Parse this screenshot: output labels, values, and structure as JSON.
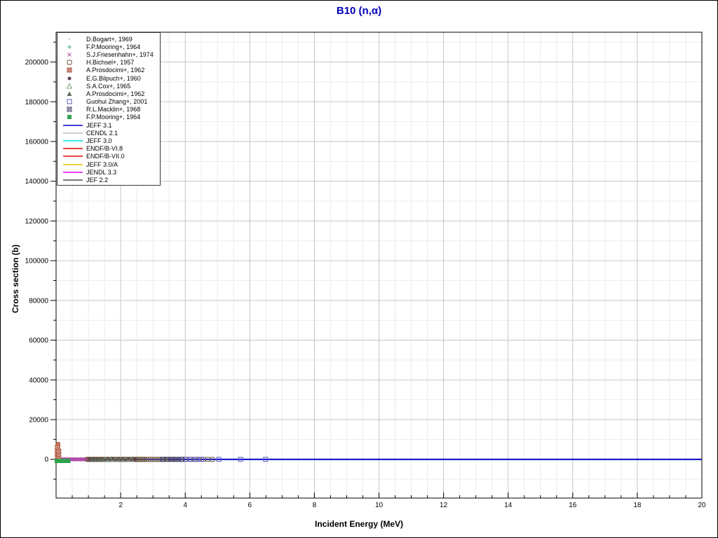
{
  "page": {
    "background": "#ffffff",
    "border_color": "#000000"
  },
  "chart_data": {
    "type": "scatter",
    "title": "B10 (n,α)",
    "title_color": "#0000bb",
    "xlabel": "Incident Energy (MeV)",
    "ylabel": "Cross section (b)",
    "xlim": [
      0,
      20
    ],
    "ylim": [
      -19500,
      215000
    ],
    "x_major_ticks": [
      2,
      4,
      6,
      8,
      10,
      12,
      14,
      16,
      18,
      20
    ],
    "x_minor_step": 0.5,
    "y_major_ticks": [
      0,
      20000,
      40000,
      60000,
      80000,
      100000,
      120000,
      140000,
      160000,
      180000,
      200000
    ],
    "y_minor_step": 10000,
    "grid": {
      "major_color": "#c6c6c6",
      "minor_color": "#ebebeb"
    },
    "zero_line_color": "#000000",
    "legend_position": "top-left",
    "evaluations": [
      {
        "name": "JEFF 3.1",
        "color": "#0000cc",
        "value": 0
      },
      {
        "name": "CENDL 2.1",
        "color": "#c0c0c0",
        "value": 0
      },
      {
        "name": "JEFF 3.0",
        "color": "#00e5e5",
        "value": 0
      },
      {
        "name": "ENDF/B-VI.8",
        "color": "#e60000",
        "value": 0
      },
      {
        "name": "ENDF/B-VII.0",
        "color": "#e60000",
        "value": 0
      },
      {
        "name": "JEFF 3.0/A",
        "color": "#e6c300",
        "value": 0
      },
      {
        "name": "JENDL 3.3",
        "color": "#e600e6",
        "value": 0
      },
      {
        "name": "JEF 2.2",
        "color": "#4d4d4d",
        "value": 0
      }
    ],
    "spike": {
      "x0": 0.005,
      "x1": 0.115,
      "y0": 0,
      "y1": 8500,
      "fill": "#c9785e",
      "stroke": "#9e4f3a"
    },
    "series": [
      {
        "id": "bogart",
        "label": "D.Bogart+, 1969",
        "marker": "dot",
        "color": "#b0b0b0",
        "x": [
          0.2,
          0.3,
          0.4,
          0.55,
          0.7,
          0.85
        ],
        "y": 0
      },
      {
        "id": "mooring-plus",
        "label": "F.P.Mooring+, 1964",
        "marker": "plus",
        "color": "#4aa87e",
        "x": [
          0.45,
          0.6,
          0.75,
          0.9
        ],
        "y": 0
      },
      {
        "id": "friesenhahn",
        "label": "S.J.Friesenhahn+, 1974",
        "marker": "x",
        "color": "#b44fae",
        "x": [
          0.13,
          0.15,
          0.17,
          0.19,
          0.21,
          0.24,
          0.26,
          0.28,
          0.3,
          0.32,
          0.35,
          0.37,
          0.39,
          0.41,
          0.43,
          0.46,
          0.48,
          0.5,
          0.52,
          0.54,
          0.57,
          0.59,
          0.61,
          0.63,
          0.65,
          0.68,
          0.7,
          0.72,
          0.74,
          0.76,
          0.79,
          0.81,
          0.83,
          0.85,
          0.87,
          0.9,
          0.92,
          0.94,
          0.96,
          0.99,
          1.01
        ],
        "y": 0
      },
      {
        "id": "bichsel",
        "label": "H.Bichsel+, 1957",
        "marker": "open-square-notch",
        "color": "#6e583c",
        "x": [
          0.98,
          1.02,
          1.06,
          1.1,
          1.14,
          1.18,
          1.22,
          1.26,
          1.3,
          1.34,
          1.38,
          1.42,
          1.46,
          1.5,
          1.54,
          1.58,
          1.62,
          1.66,
          1.7,
          1.74,
          1.78,
          1.82,
          1.86,
          1.9,
          1.94,
          1.98,
          2.02,
          2.06,
          2.1,
          2.14,
          2.18,
          2.22,
          2.26,
          2.3,
          2.34,
          2.38,
          2.42,
          2.46,
          2.5,
          2.54,
          2.58,
          2.62,
          2.66,
          2.7,
          2.74,
          2.8,
          2.86,
          2.92,
          2.98,
          3.04,
          3.1,
          3.16,
          3.22,
          3.28,
          3.34,
          3.4,
          3.46,
          3.52,
          3.58,
          3.66,
          3.76,
          3.88,
          4.0,
          4.14,
          4.28,
          4.42,
          4.56,
          4.7,
          4.84
        ],
        "y": 0
      },
      {
        "id": "prosdocimi-hatched",
        "label": "A.Prosdocimi+, 1962",
        "marker": "hatched-square",
        "color": "#aa5544",
        "fill": "#eec9a8",
        "x": [
          0.04,
          0.04,
          0.04,
          0.04,
          0.08,
          0.08,
          0.08
        ],
        "ys": [
          1500,
          3000,
          4500,
          6000,
          1000,
          2500,
          4000
        ]
      },
      {
        "id": "bilpuch",
        "label": "E.G.Bilpuch+, 1960",
        "marker": "filled-circle",
        "color": "#5c4050",
        "x": [
          1.05,
          1.15,
          1.25,
          1.35,
          1.45,
          1.55,
          1.65,
          1.75,
          1.85,
          1.95,
          2.05,
          2.15,
          2.25,
          2.35,
          2.45
        ],
        "y": 0
      },
      {
        "id": "cox",
        "label": "S.A.Cox+, 1965",
        "marker": "open-triangle",
        "color": "#7fa080",
        "x": [
          1.52,
          1.68,
          1.84,
          2.0,
          2.16,
          2.32
        ],
        "y": 0
      },
      {
        "id": "prosdocimi-triangle",
        "label": "A.Prosdocimi+, 1962",
        "marker": "filled-triangle",
        "color": "#5d6b58",
        "x": [
          1.1,
          1.22,
          1.34,
          1.46
        ],
        "y": 0
      },
      {
        "id": "zhang",
        "label": "Guohui Zhang+, 2001",
        "marker": "open-square",
        "color": "#5c5cbe",
        "x": [
          3.86,
          4.02,
          4.18,
          4.34,
          4.5,
          5.04,
          5.71,
          6.49
        ],
        "y": 0
      },
      {
        "id": "macklin",
        "label": "R.L.Macklin+, 1968",
        "marker": "crossed-square",
        "color": "#4a4a6e",
        "x": [
          3.3,
          3.44,
          3.58,
          3.72,
          3.9
        ],
        "y": 0
      },
      {
        "id": "mooring-square",
        "label": "F.P.Mooring+, 1964",
        "marker": "filled-square",
        "color": "#2fa24e",
        "x": [
          0.02,
          0.07,
          0.12,
          0.17,
          0.22,
          0.27,
          0.32,
          0.38
        ],
        "y": -800
      }
    ]
  },
  "legend": {
    "entries": [
      {
        "kind": "marker",
        "marker": "dot",
        "color": "#b0b0b0",
        "label": "D.Bogart+, 1969"
      },
      {
        "kind": "marker",
        "marker": "plus",
        "color": "#4aa87e",
        "label": "F.P.Mooring+, 1964"
      },
      {
        "kind": "marker",
        "marker": "x",
        "color": "#b44fae",
        "label": "S.J.Friesenhahn+, 1974"
      },
      {
        "kind": "marker",
        "marker": "open-square-notch",
        "color": "#6e583c",
        "label": "H.Bichsel+, 1957"
      },
      {
        "kind": "marker",
        "marker": "hatched-square",
        "color": "#aa5544",
        "fill": "#eec9a8",
        "label": "A.Prosdocimi+, 1962"
      },
      {
        "kind": "marker",
        "marker": "filled-circle",
        "color": "#5c4050",
        "label": "E.G.Bilpuch+, 1960"
      },
      {
        "kind": "marker",
        "marker": "open-triangle",
        "color": "#7fa080",
        "label": "S.A.Cox+, 1965"
      },
      {
        "kind": "marker",
        "marker": "filled-triangle",
        "color": "#5d6b58",
        "label": "A.Prosdocimi+, 1962"
      },
      {
        "kind": "marker",
        "marker": "open-square",
        "color": "#5c5cbe",
        "label": "Guohui Zhang+, 2001"
      },
      {
        "kind": "marker",
        "marker": "crossed-square",
        "color": "#4a4a6e",
        "label": "R.L.Macklin+, 1968"
      },
      {
        "kind": "marker",
        "marker": "filled-square",
        "color": "#2fa24e",
        "label": "F.P.Mooring+, 1964"
      },
      {
        "kind": "line",
        "color": "#0000cc",
        "label": "JEFF 3.1"
      },
      {
        "kind": "line",
        "color": "#c0c0c0",
        "label": "CENDL 2.1"
      },
      {
        "kind": "line",
        "color": "#00e5e5",
        "label": "JEFF 3.0"
      },
      {
        "kind": "line",
        "color": "#e60000",
        "label": "ENDF/B-VI.8"
      },
      {
        "kind": "line",
        "color": "#e60000",
        "label": "ENDF/B-VII.0"
      },
      {
        "kind": "line",
        "color": "#e6c300",
        "label": "JEFF 3.0/A"
      },
      {
        "kind": "line",
        "color": "#e600e6",
        "label": "JENDL 3.3"
      },
      {
        "kind": "line",
        "color": "#4d4d4d",
        "label": "JEF 2.2"
      }
    ]
  }
}
